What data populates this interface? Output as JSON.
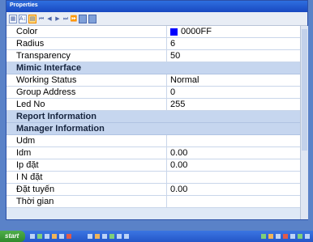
{
  "window": {
    "title": "Properties"
  },
  "toolbar": {
    "buttons": [
      "categorized",
      "alphabetic",
      "properties",
      "first",
      "prev",
      "play",
      "next",
      "last",
      "grid",
      "list"
    ]
  },
  "properties": [
    {
      "name": "Color",
      "value": "0000FF",
      "swatch": "#0000ff"
    },
    {
      "name": "Radius",
      "value": "6"
    },
    {
      "name": "Transparency",
      "value": "50"
    }
  ],
  "mimic": {
    "label": "Mimic Interface",
    "rows": [
      {
        "name": "Working Status",
        "value": "Normal"
      },
      {
        "name": "Group Address",
        "value": "0"
      },
      {
        "name": "Led No",
        "value": "255"
      }
    ]
  },
  "report": {
    "label": "Report Information"
  },
  "manager": {
    "label": "Manager Information",
    "rows": [
      {
        "name": "Udm",
        "value": ""
      },
      {
        "name": "Idm",
        "value": "0.00"
      },
      {
        "name": "Ip đặt",
        "value": "0.00"
      },
      {
        "name": "I N đặt",
        "value": ""
      },
      {
        "name": "Đặt tuyến",
        "value": "0.00"
      },
      {
        "name": "Thời gian",
        "value": ""
      }
    ]
  },
  "taskbar": {
    "start_label": "start"
  }
}
